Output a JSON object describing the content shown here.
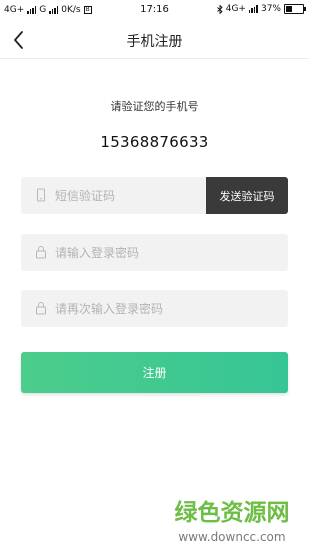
{
  "status_bar": {
    "left_network1": "4G+",
    "left_network2": "G",
    "speed": "0K/s",
    "speed_badge": "B",
    "time": "17:16",
    "right_network": "4G+",
    "battery_text": "37%",
    "battery_level": 0.37
  },
  "header": {
    "back_icon": "chevron-left-icon",
    "title": "手机注册"
  },
  "verify": {
    "prompt": "请验证您的手机号",
    "phone": "15368876633"
  },
  "form": {
    "sms_code": {
      "icon": "phone-icon",
      "placeholder": "短信验证码",
      "value": ""
    },
    "send_code_label": "发送验证码",
    "password": {
      "icon": "lock-icon",
      "placeholder": "请输入登录密码",
      "value": ""
    },
    "confirm_password": {
      "icon": "lock-icon",
      "placeholder": "请再次输入登录密码",
      "value": ""
    },
    "register_label": "注册"
  },
  "watermark": {
    "text": "绿色资源网",
    "url": "www.downcc.com"
  },
  "colors": {
    "accent_start": "#4ccd8c",
    "accent_end": "#36c595",
    "send_button": "#3a3a3a",
    "field_bg": "#f2f2f2",
    "watermark_green": "#6dbe45"
  }
}
